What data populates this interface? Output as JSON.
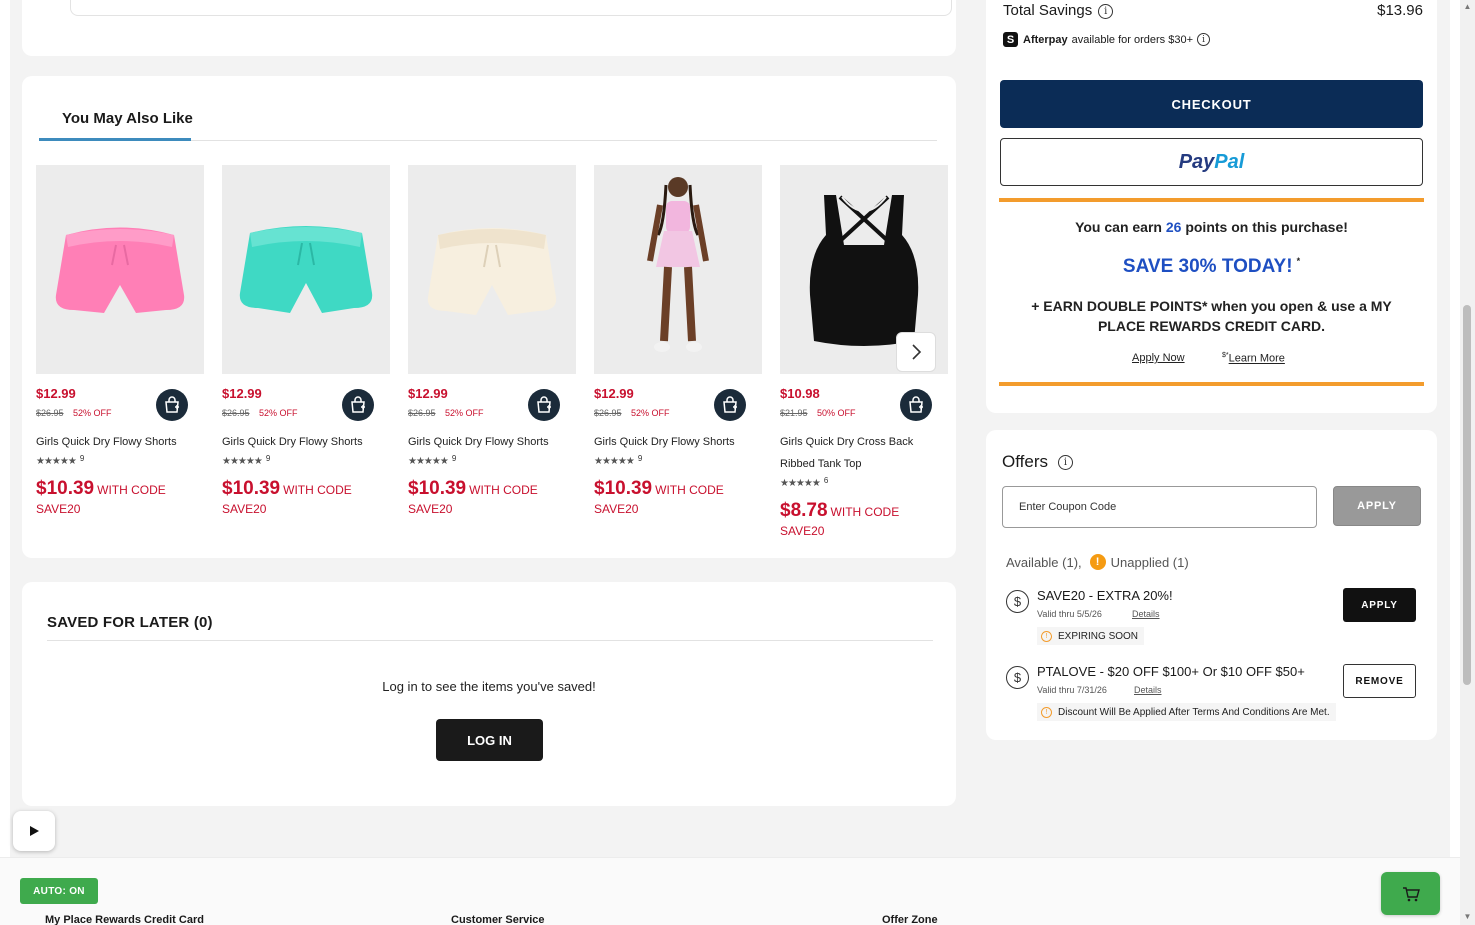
{
  "recommendations": {
    "tab_label": "You May Also Like",
    "products": [
      {
        "price": "$12.99",
        "original_price": "$26.95",
        "discount": "52% OFF",
        "name": "Girls Quick Dry Flowy Shorts",
        "rating": 4.5,
        "stars": "★★★★★",
        "review_count": "9",
        "sale_price": "$10.39",
        "with_code": "WITH CODE",
        "code": "SAVE20",
        "color": "#ff7fb6"
      },
      {
        "price": "$12.99",
        "original_price": "$26.95",
        "discount": "52% OFF",
        "name": "Girls Quick Dry Flowy Shorts",
        "rating": 4.5,
        "stars": "★★★★★",
        "review_count": "9",
        "sale_price": "$10.39",
        "with_code": "WITH CODE",
        "code": "SAVE20",
        "color": "#3fd9c4"
      },
      {
        "price": "$12.99",
        "original_price": "$26.95",
        "discount": "52% OFF",
        "name": "Girls Quick Dry Flowy Shorts",
        "rating": 4.5,
        "stars": "★★★★★",
        "review_count": "9",
        "sale_price": "$10.39",
        "with_code": "WITH CODE",
        "code": "SAVE20",
        "color": "#f5ecd9"
      },
      {
        "price": "$12.99",
        "original_price": "$26.95",
        "discount": "52% OFF",
        "name": "Girls Quick Dry Flowy Shorts",
        "rating": 4.5,
        "stars": "★★★★★",
        "review_count": "9",
        "sale_price": "$10.39",
        "with_code": "WITH CODE",
        "code": "SAVE20",
        "color": "#f2c6e3"
      },
      {
        "price": "$10.98",
        "original_price": "$21.95",
        "discount": "50% OFF",
        "name": "Girls Quick Dry Cross Back Ribbed Tank Top",
        "rating": 5,
        "stars": "★★★★★",
        "review_count": "6",
        "sale_price": "$8.78",
        "with_code": "WITH CODE",
        "code": "SAVE20",
        "color": "#111111"
      }
    ]
  },
  "saved_for_later": {
    "title": "SAVED FOR LATER (0)",
    "message": "Log in to see the items you've saved!",
    "login_label": "LOG IN"
  },
  "summary": {
    "total_savings_label": "Total Savings",
    "total_savings_value": "$13.96",
    "afterpay_logo": "S",
    "afterpay_brand": "Afterpay",
    "afterpay_text": "available for orders $30+",
    "checkout_label": "CHECKOUT",
    "paypal_part1": "Pay",
    "paypal_part2": "Pal",
    "earn_prefix": "You can earn",
    "earn_points": "26",
    "earn_suffix": "points on this purchase!",
    "save30": "SAVE 30% TODAY!",
    "save30_mark": "*",
    "double_points": "+ EARN DOUBLE POINTS* when you open & use a MY PLACE REWARDS CREDIT CARD.",
    "apply_now": "Apply Now",
    "learn_more_mark": "$*",
    "learn_more": "Learn More"
  },
  "offers": {
    "title": "Offers",
    "coupon_placeholder": "Enter Coupon Code",
    "apply_label": "APPLY",
    "available": "Available (1),",
    "unapplied": "Unapplied (1)",
    "coupons": [
      {
        "name": "SAVE20 - EXTRA 20%!",
        "valid": "Valid thru 5/5/26",
        "details": "Details",
        "badge": "EXPIRING SOON",
        "action": "APPLY"
      },
      {
        "name": "PTALOVE - $20 OFF $100+ Or $10 OFF $50+",
        "valid": "Valid thru 7/31/26",
        "details": "Details",
        "badge": "Discount Will Be Applied After Terms And Conditions Are Met.",
        "action": "REMOVE"
      }
    ]
  },
  "floating": {
    "auto_label": "AUTO: ON"
  },
  "footer": {
    "links": [
      "My Place Rewards Credit Card",
      "Customer Service",
      "Offer Zone"
    ]
  },
  "colors": {
    "sale_red": "#c8102e",
    "checkout_navy": "#0b2c56",
    "rewards_blue": "#1e4fc2",
    "accent_orange": "#f39c2d",
    "auto_green": "#3faa4d",
    "tab_underline": "#3d8bbd"
  }
}
